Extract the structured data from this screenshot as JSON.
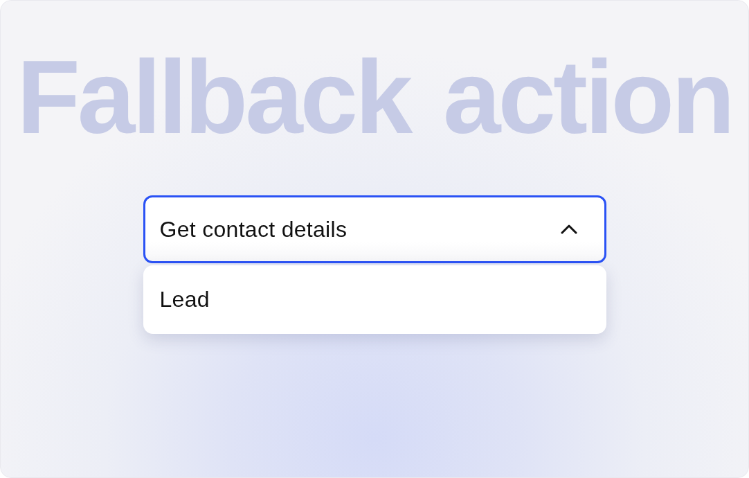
{
  "heading": "Fallback action",
  "dropdown": {
    "value": "Get contact details",
    "expanded": true,
    "options": [
      {
        "label": "Lead",
        "selected": false
      }
    ]
  }
}
